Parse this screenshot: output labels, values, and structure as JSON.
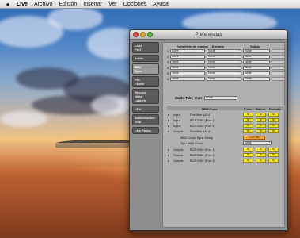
{
  "menubar": {
    "apple_icon": "apple-icon",
    "items": [
      "Live",
      "Archivo",
      "Edición",
      "Insertar",
      "Ver",
      "Opciones",
      "Ayuda"
    ]
  },
  "window": {
    "title": "Preferencias",
    "controls": [
      "close-icon",
      "minimize-icon",
      "zoom-icon"
    ]
  },
  "sidebar": {
    "tabs": [
      {
        "label": "Look\nFeel",
        "active": false
      },
      {
        "label": "Audio",
        "active": false
      },
      {
        "label": "MIDI\nSync",
        "active": true
      },
      {
        "label": "File\nFolder",
        "active": false
      },
      {
        "label": "Record\nWarp\nLaunch",
        "active": false
      },
      {
        "label": "CPU",
        "active": false
      },
      {
        "label": "Authorization\nTrial",
        "active": false
      },
      {
        "label": "Live Packs",
        "active": false
      }
    ]
  },
  "control_surfaces": {
    "headers": {
      "surface": "Superficie de control",
      "input": "Entrada",
      "output": "Salida"
    },
    "rows": [
      {
        "num": "1",
        "surface": "None",
        "input": "None",
        "output": "None"
      },
      {
        "num": "2",
        "surface": "None",
        "input": "None",
        "output": "None"
      },
      {
        "num": "3",
        "surface": "None",
        "input": "None",
        "output": "None"
      },
      {
        "num": "4",
        "surface": "None",
        "input": "None",
        "output": "None"
      },
      {
        "num": "5",
        "surface": "None",
        "input": "None",
        "output": "None"
      },
      {
        "num": "6",
        "surface": "None",
        "input": "None",
        "output": "None"
      }
    ]
  },
  "takeover": {
    "label": "Modo Take-Over",
    "value": "None"
  },
  "midi_ports": {
    "headers": {
      "port": "MIDI Ports",
      "track": "Pista",
      "sync": "Sincro",
      "remote": "Remoto"
    },
    "input_rows": [
      {
        "io": "Input:",
        "device": "FireWire 1814",
        "track": "Sí",
        "sync": "Sí",
        "remote": "Sí"
      },
      {
        "io": "Input:",
        "device": "BCR2000 (Port 1)",
        "track": "Sí",
        "sync": "Sí",
        "remote": "Sí"
      },
      {
        "io": "Input:",
        "device": "BCR2000 (Port 2)",
        "track": "Sí",
        "sync": "Sí",
        "remote": "Sí"
      },
      {
        "io": "Output:",
        "device": "FireWire 1814",
        "track": "Sí",
        "sync": "Sí",
        "remote": "Sí"
      }
    ],
    "clock_delay": {
      "label": "MIDI Clock Sync Delay",
      "value": "0.00 ms"
    },
    "clock_type": {
      "label": "Tipo MIDI Clock",
      "value": "Song"
    },
    "output_rows": [
      {
        "io": "Output:",
        "device": "BCR2000 (Port 1)",
        "track": "Sí",
        "sync": "Sí",
        "remote": "Sí"
      },
      {
        "io": "Output:",
        "device": "BCR2000 (Port 2)",
        "track": "Sí",
        "sync": "Sí",
        "remote": "Sí"
      },
      {
        "io": "Output:",
        "device": "BCR2000 (Port 3)",
        "track": "Sí",
        "sync": "Sí",
        "remote": "Sí"
      }
    ]
  }
}
